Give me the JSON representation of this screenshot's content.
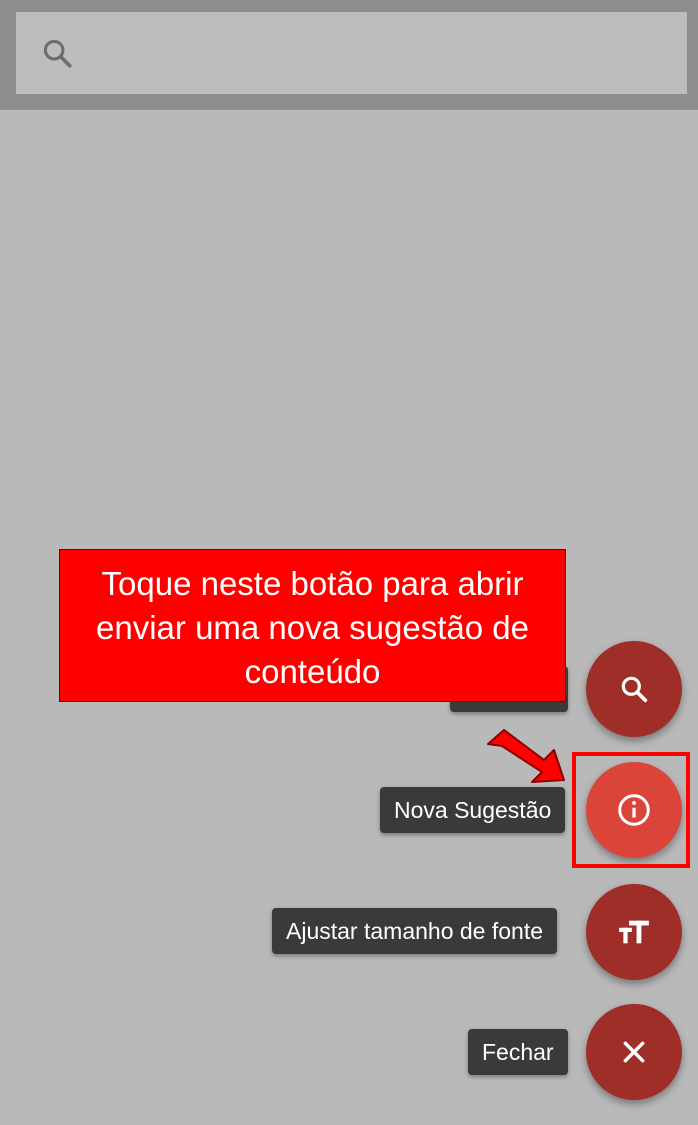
{
  "search": {
    "placeholder": "",
    "icon": "search-icon"
  },
  "fab_menu": {
    "items": [
      {
        "label": "",
        "icon": "search-icon"
      },
      {
        "label": "Nova Sugestão",
        "icon": "info-icon"
      },
      {
        "label": "Ajustar tamanho de fonte",
        "icon": "text-size-icon"
      },
      {
        "label": "Fechar",
        "icon": "close-icon"
      }
    ]
  },
  "tutorial": {
    "callout_line1": "Toque neste botão para abrir",
    "callout_line2": "enviar uma nova sugestão de",
    "callout_line3": "conteúdo"
  },
  "colors": {
    "fab_dark": "#9e2e27",
    "fab_active": "#db4438",
    "callout": "#ff0000",
    "overlay": "#b9b9b9"
  }
}
